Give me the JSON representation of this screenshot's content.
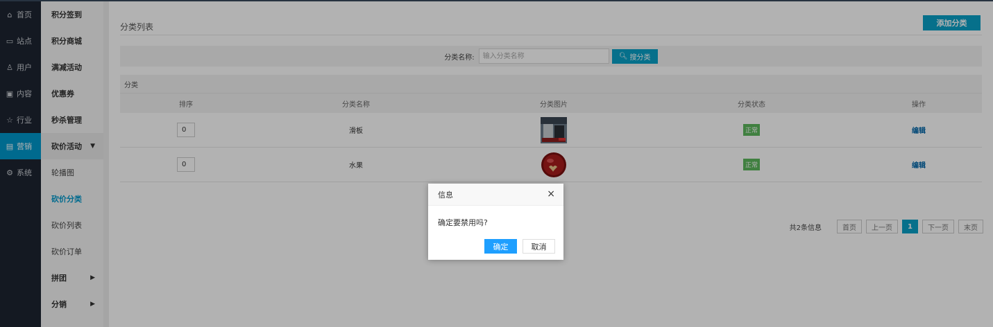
{
  "nav_primary": [
    {
      "label": "首页",
      "icon": "home-icon",
      "glyph": "⌂"
    },
    {
      "label": "站点",
      "icon": "monitor-icon",
      "glyph": "▭"
    },
    {
      "label": "用户",
      "icon": "user-icon",
      "glyph": "♙"
    },
    {
      "label": "内容",
      "icon": "inbox-icon",
      "glyph": "▣"
    },
    {
      "label": "行业",
      "icon": "star-icon",
      "glyph": "☆"
    },
    {
      "label": "营销",
      "icon": "marketing-icon",
      "glyph": "▤"
    },
    {
      "label": "系统",
      "icon": "gear-icon",
      "glyph": "⚙"
    }
  ],
  "nav_secondary": {
    "items": [
      "积分签到",
      "积分商城",
      "满减活动",
      "优惠券",
      "秒杀管理"
    ],
    "group_open": "砍价活动",
    "sub_items": [
      "轮播图",
      "砍价分类",
      "砍价列表",
      "砍价订单"
    ],
    "tail_items": [
      "拼团",
      "分销"
    ]
  },
  "main": {
    "title": "分类列表",
    "add_button": "添加分类",
    "search": {
      "label": "分类名称:",
      "placeholder": "输入分类名称",
      "button": "搜分类"
    },
    "table": {
      "caption": "分类",
      "headers": [
        "排序",
        "分类名称",
        "分类图片",
        "分类状态",
        "操作"
      ],
      "rows": [
        {
          "sort": "0",
          "name": "滑板",
          "image": "skateboard-image",
          "status": "正常",
          "action": "编辑"
        },
        {
          "sort": "0",
          "name": "水果",
          "image": "fruit-image",
          "status": "正常",
          "action": "编辑"
        }
      ]
    },
    "pager": {
      "info": "共2条信息",
      "first": "首页",
      "prev": "上一页",
      "current": "1",
      "next": "下一页",
      "last": "末页"
    }
  },
  "dialog": {
    "title": "信息",
    "close": "×",
    "message": "确定要禁用吗?",
    "ok": "确定",
    "cancel": "取消"
  },
  "colors": {
    "nav_bg": "#1e2532",
    "accent": "#0aa1c8",
    "status_ok": "#5cb85c",
    "dialog_ok": "#1e9fff"
  }
}
